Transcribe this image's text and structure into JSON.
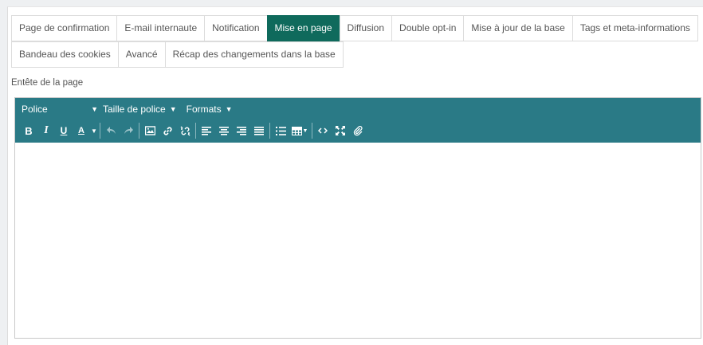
{
  "tabs": {
    "row1": [
      {
        "label": "Page de confirmation",
        "active": false
      },
      {
        "label": "E-mail internaute",
        "active": false
      },
      {
        "label": "Notification",
        "active": false
      },
      {
        "label": "Mise en page",
        "active": true
      },
      {
        "label": "Diffusion",
        "active": false
      },
      {
        "label": "Double opt-in",
        "active": false
      },
      {
        "label": "Mise à jour de la base",
        "active": false
      },
      {
        "label": "Tags et meta-informations",
        "active": false
      }
    ],
    "row2": [
      {
        "label": "Bandeau des cookies",
        "active": false
      },
      {
        "label": "Avancé",
        "active": false
      },
      {
        "label": "Récap des changements dans la base",
        "active": false
      }
    ]
  },
  "field_label": "Entête de la page",
  "toolbar": {
    "font_menu": "Police",
    "size_menu": "Taille de police",
    "formats_menu": "Formats",
    "buttons": {
      "bold": "B",
      "italic": "I",
      "underline": "U",
      "font_color": "A"
    }
  },
  "editor": {
    "content": ""
  },
  "colors": {
    "active_tab": "#0f6a5c",
    "toolbar_bg": "#2a7a86"
  }
}
